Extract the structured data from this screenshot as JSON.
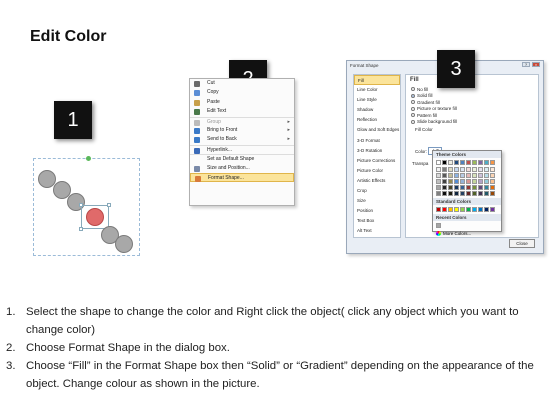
{
  "title": "Edit Color",
  "steps": [
    "1",
    "2",
    "3"
  ],
  "context_menu": {
    "items": [
      {
        "label": "Cut",
        "icon": "scissors-icon",
        "color": "#6a6a6a",
        "submenu": false,
        "disabled": false
      },
      {
        "label": "Copy",
        "icon": "copy-icon",
        "color": "#5b8ed6",
        "submenu": false,
        "disabled": false
      },
      {
        "label": "Paste",
        "icon": "paste-icon",
        "color": "#c8a04a",
        "submenu": false,
        "disabled": false
      },
      {
        "label": "Edit Text",
        "icon": "edit-text-icon",
        "color": "#4a7a4a",
        "submenu": false,
        "disabled": false
      },
      {
        "label": "Group",
        "icon": "group-icon",
        "color": "#bbbbbb",
        "submenu": true,
        "disabled": true
      },
      {
        "label": "Bring to Front",
        "icon": "bring-front-icon",
        "color": "#3a7ac8",
        "submenu": true,
        "disabled": false
      },
      {
        "label": "Send to Back",
        "icon": "send-back-icon",
        "color": "#3a7ac8",
        "submenu": true,
        "disabled": false
      },
      {
        "label": "Hyperlink...",
        "icon": "hyperlink-icon",
        "color": "#3a6ab8",
        "submenu": false,
        "disabled": false
      },
      {
        "label": "Set as Default Shape",
        "icon": "",
        "color": "",
        "submenu": false,
        "disabled": false
      },
      {
        "label": "Size and Position...",
        "icon": "size-position-icon",
        "color": "#7a8aa8",
        "submenu": false,
        "disabled": false
      },
      {
        "label": "Format Shape...",
        "icon": "format-shape-icon",
        "color": "#d87a3a",
        "submenu": false,
        "disabled": false
      }
    ]
  },
  "dialog": {
    "title": "Format Shape",
    "nav": [
      "Fill",
      "Line Color",
      "Line Style",
      "Shadow",
      "Reflection",
      "Glow and Soft Edges",
      "3-D Format",
      "3-D Rotation",
      "Picture Corrections",
      "Picture Color",
      "Artistic Effects",
      "Crop",
      "Size",
      "Position",
      "Text Box",
      "Alt Text"
    ],
    "fill_heading": "Fill",
    "options": [
      "No fill",
      "Solid fill",
      "Gradient fill",
      "Picture or texture fill",
      "Pattern fill",
      "Slide background fill"
    ],
    "fill_color_label": "Fill Color",
    "color_label": "Color:",
    "transparency_label": "Transpa",
    "close_label": "Close"
  },
  "color_dropdown": {
    "theme_label": "Theme Colors",
    "standard_label": "Standard Colors",
    "recent_label": "Recent Colors",
    "more_label": "More Colors...",
    "theme_top": [
      "#ffffff",
      "#000000",
      "#eeece1",
      "#1f497d",
      "#4f81bd",
      "#c0504d",
      "#9bbb59",
      "#8064a2",
      "#4bacc6",
      "#f79646"
    ],
    "theme_shades": [
      [
        "#f2f2f2",
        "#7f7f7f",
        "#ddd9c3",
        "#c6d9f0",
        "#dbe5f1",
        "#f2dcdb",
        "#ebf1dd",
        "#e5e0ec",
        "#dbeef3",
        "#fdeada"
      ],
      [
        "#d8d8d8",
        "#595959",
        "#c4bd97",
        "#8db3e2",
        "#b8cce4",
        "#e5b9b7",
        "#d7e3bc",
        "#ccc1d9",
        "#b7dde8",
        "#fbd5b5"
      ],
      [
        "#bfbfbf",
        "#3f3f3f",
        "#938953",
        "#548dd4",
        "#95b3d7",
        "#d99694",
        "#c3d69b",
        "#b2a2c7",
        "#92cddc",
        "#fac08f"
      ],
      [
        "#a5a5a5",
        "#262626",
        "#494429",
        "#17365d",
        "#366092",
        "#953734",
        "#76923c",
        "#5f497a",
        "#31859b",
        "#e36c09"
      ],
      [
        "#7f7f7f",
        "#0c0c0c",
        "#1d1b10",
        "#0f243e",
        "#244061",
        "#632423",
        "#4f6128",
        "#3f3151",
        "#205867",
        "#974806"
      ]
    ],
    "standard": [
      "#c00000",
      "#ff0000",
      "#ffc000",
      "#ffff00",
      "#92d050",
      "#00b050",
      "#00b0f0",
      "#0070c0",
      "#002060",
      "#7030a0"
    ],
    "recent": [
      "#a6a6a6"
    ]
  },
  "instructions": [
    {
      "num": "1.",
      "text": "Select the shape to change the color and Right click the object( click any object which you want to change color)"
    },
    {
      "num": "2.",
      "text": "Choose Format Shape in the dialog box."
    },
    {
      "num": "3.",
      "text": "Choose “Fill” in the Format Shape box then “Solid” or “Gradient” depending on the appearance of the object. Change colour as shown in the picture."
    }
  ]
}
